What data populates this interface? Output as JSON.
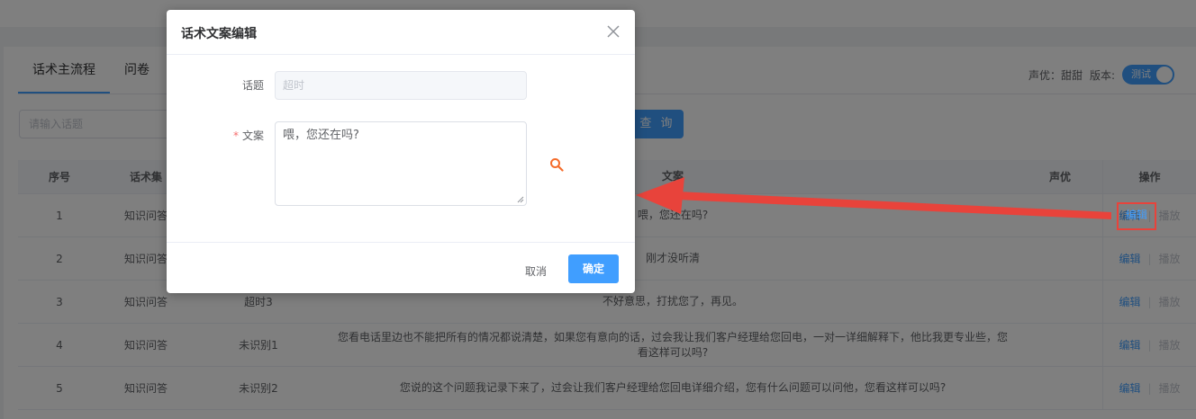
{
  "tabs": [
    {
      "label": "话术主流程"
    },
    {
      "label": "问卷"
    }
  ],
  "voice_info": {
    "voice_label": "声优：甜甜",
    "version_label": "版本:",
    "toggle_text": "测试"
  },
  "search": {
    "placeholder": "请输入话题",
    "query_label": "查 询"
  },
  "table": {
    "headers": {
      "no": "序号",
      "set": "话术集",
      "text": "文案",
      "voice": "声优",
      "op": "操作"
    },
    "rows": [
      {
        "no": "1",
        "set": "知识问答",
        "topic": "",
        "text": "喂，您还在吗?",
        "edit": "编辑",
        "play": "播放"
      },
      {
        "no": "2",
        "set": "知识问答",
        "topic": "",
        "text": "刚才没听清",
        "edit": "编辑",
        "play": "播放"
      },
      {
        "no": "3",
        "set": "知识问答",
        "topic": "超时3",
        "text": "不好意思，打扰您了，再见。",
        "edit": "编辑",
        "play": "播放"
      },
      {
        "no": "4",
        "set": "知识问答",
        "topic": "未识别1",
        "text": "您看电话里边也不能把所有的情况都说清楚，如果您有意向的话，过会我让我们客户经理给您回电，一对一详细解释下，他比我更专业些，您看这样可以吗?",
        "edit": "编辑",
        "play": "播放"
      },
      {
        "no": "5",
        "set": "知识问答",
        "topic": "未识别2",
        "text": "您说的这个问题我记录下来了，过会让我们客户经理给您回电详细介绍，您有什么问题可以问他，您看这样可以吗?",
        "edit": "编辑",
        "play": "播放"
      }
    ]
  },
  "dialog": {
    "title": "话术文案编辑",
    "topic_label": "话题",
    "topic_value": "超时",
    "text_label": "文案",
    "required_mark": "*",
    "text_value": "喂，您还在吗?",
    "cancel_label": "取消",
    "confirm_label": "确定"
  },
  "annotation": {
    "highlight_label": "编辑",
    "color": "#e8433b"
  },
  "colors": {
    "primary": "#409eff",
    "search_icon": "#f56c2b"
  }
}
